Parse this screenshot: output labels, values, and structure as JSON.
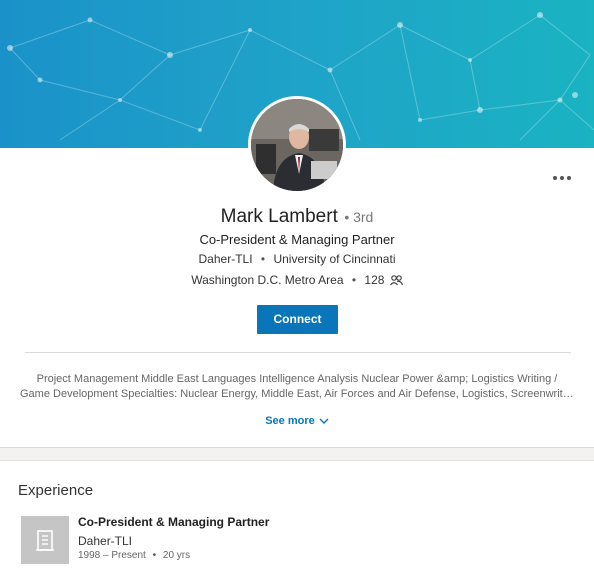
{
  "profile": {
    "name": "Mark Lambert",
    "degree": "• 3rd",
    "headline": "Co-President & Managing Partner",
    "company": "Daher-TLI",
    "school": "University of Cincinnati",
    "location": "Washington D.C. Metro Area",
    "connections": "128",
    "bullet": "•"
  },
  "actions": {
    "connect_label": "Connect",
    "see_more_label": "See more"
  },
  "summary": {
    "line1": "Project Management Middle East Languages Intelligence Analysis Nuclear Power &amp; Logistics Writing /",
    "line2": "Game Development Specialties: Nuclear Energy, Middle East, Air Forces and Air Defense, Logistics, Screenwriting, ..."
  },
  "experience": {
    "section_title": "Experience",
    "items": [
      {
        "title": "Co-President & Managing Partner",
        "company": "Daher-TLI",
        "dates": "1998 – Present",
        "duration": "20 yrs"
      }
    ]
  },
  "colors": {
    "accent": "#0a75b8",
    "banner": "#1ba2c8"
  },
  "icons": {
    "more": "ellipsis-icon",
    "connections": "people-icon",
    "see_more": "chevron-down-icon",
    "company_logo": "building-icon"
  }
}
